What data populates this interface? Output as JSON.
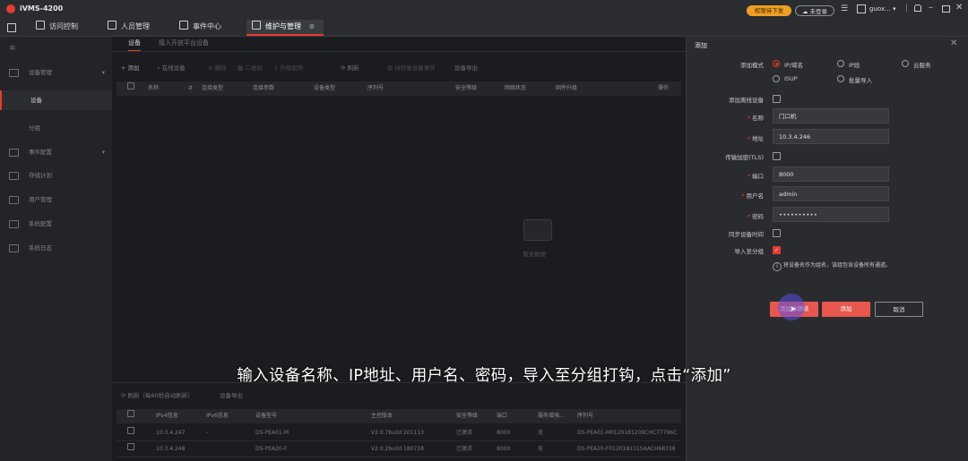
{
  "app": {
    "title": "iVMS-4200"
  },
  "titlebar": {
    "upgrade_label": "权限待下发",
    "login_label": "未登录",
    "user_label": "guox..."
  },
  "nav": {
    "tabs": [
      {
        "label": "访问控制"
      },
      {
        "label": "人员管理"
      },
      {
        "label": "事件中心"
      },
      {
        "label": "维护与管理"
      }
    ]
  },
  "sidebar": {
    "items": [
      {
        "label": "设备管理"
      },
      {
        "label": "设备"
      },
      {
        "label": "分组"
      },
      {
        "label": "事件配置"
      },
      {
        "label": "存储计划"
      },
      {
        "label": "用户管理"
      },
      {
        "label": "系统配置"
      },
      {
        "label": "系统日志"
      }
    ]
  },
  "main": {
    "subtabs": [
      "设备",
      "接入开放平台设备"
    ],
    "toolbar": [
      "添加",
      "在线设备",
      "删除",
      "二维码",
      "升级固件",
      "刷新",
      "待恢复设备事件",
      "设备导出"
    ],
    "table_headers": [
      "名称",
      "连接类型",
      "连接参数",
      "设备类型",
      "序列号",
      "安全等级",
      "网络状态",
      "固件升级",
      "操作"
    ],
    "empty_text": "暂无数据",
    "online": {
      "refresh_label": "刷新（每60秒自动刷新）",
      "export_label": "设备导出",
      "headers": [
        "IPv4信息",
        "IPv6信息",
        "设备型号",
        "主控版本",
        "安全等级",
        "端口",
        "服务增强...",
        "序列号"
      ],
      "rows": [
        {
          "ipv4": "10.3.4.247",
          "ipv6": "-",
          "model": "DS-PEA01-M",
          "version": "V2.0.7build 201113",
          "security": "已激活",
          "port": "8000",
          "service": "无",
          "serial": "DS-PEA01-M0120181209CHC77796C"
        },
        {
          "ipv4": "10.3.4.248",
          "ipv6": "",
          "model": "DS-PEA20-F",
          "version": "V2.0.2build 180718",
          "security": "已激活",
          "port": "8000",
          "service": "无",
          "serial": "DS-PEA20-F0120181115AACH68338"
        }
      ]
    }
  },
  "panel": {
    "title": "添加",
    "mode_label": "添加模式",
    "modes": [
      "IP/域名",
      "IP段",
      "云服务",
      "ISUP",
      "批量导入"
    ],
    "offline_label": "添加离线设备",
    "name_label": "名称",
    "name_value": "门口机",
    "address_label": "地址",
    "address_value": "10.3.4.246",
    "tls_label": "传输加密(TLS)",
    "port_label": "端口",
    "port_value": "8000",
    "username_label": "用户名",
    "username_value": "admin",
    "password_label": "密码",
    "password_value": "••••••••••",
    "sync_label": "同步设备时间",
    "import_label": "导入至分组",
    "hint": "将设备名作为组名，该组包含设备所有通道。",
    "buttons": {
      "add_continue": "添加并继续",
      "add": "添加",
      "cancel": "取消"
    }
  },
  "subtitle": "输入设备名称、IP地址、用户名、密码，导入至分组打钩，点击“添加”",
  "colors": {
    "accent": "#e43c2f",
    "upgrade_pill": "#f0a020",
    "hover_circle": "#5b4fe0"
  }
}
